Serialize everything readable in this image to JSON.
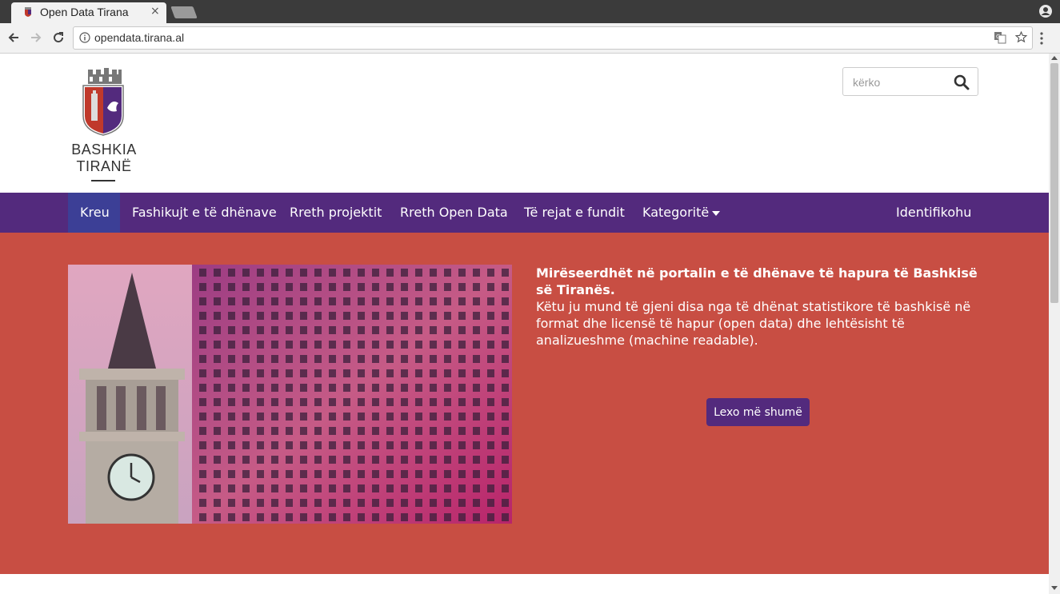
{
  "browser": {
    "tab_title": "Open Data Tirana",
    "tab_close": "×",
    "url": "opendata.tirana.al"
  },
  "header": {
    "logo_line1": "BASHKIA",
    "logo_line2": "TIRANË",
    "search_placeholder": "kërko"
  },
  "nav": {
    "items": [
      {
        "label": "Kreu",
        "active": true
      },
      {
        "label": "Fashikujt e të dhënave"
      },
      {
        "label": "Rreth projektit"
      },
      {
        "label": "Rreth Open Data"
      },
      {
        "label": "Të rejat e fundit"
      },
      {
        "label": "Kategoritë"
      }
    ],
    "login": "Identifikohu"
  },
  "hero": {
    "heading": "Mirëseerdhët në portalin e të dhënave të hapura të Bashkisë së Tiranës.",
    "body": "Këtu ju mund të gjeni disa nga të dhënat statistikore të bashkisë në format dhe licensë të hapur (open data) dhe lehtësisht të analizueshme (machine readable).",
    "button": "Lexo më shumë"
  },
  "colors": {
    "brand_purple": "#532a7d",
    "active_nav": "#3c3f96",
    "hero_red": "#c84e43"
  }
}
